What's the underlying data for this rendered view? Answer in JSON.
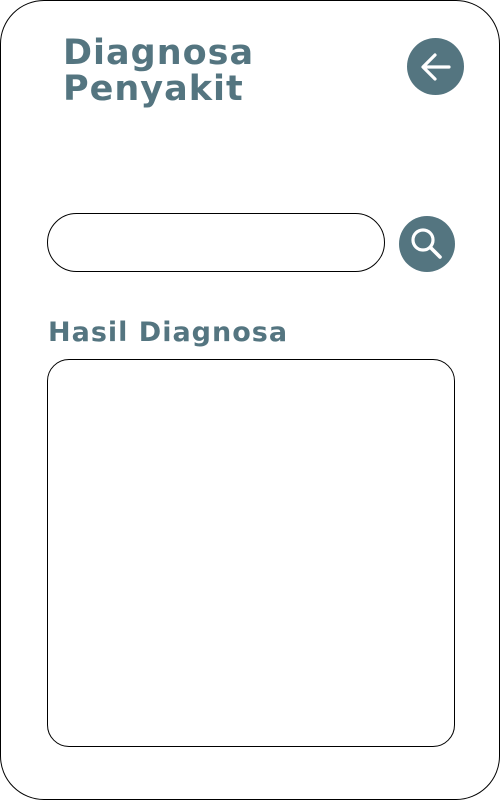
{
  "header": {
    "title_line1": "Diagnosa",
    "title_line2": "Penyakit",
    "back_icon": "arrow-left-icon"
  },
  "search": {
    "value": "",
    "placeholder": "",
    "icon": "search-icon"
  },
  "result": {
    "heading": "Hasil Diagnosa",
    "content": ""
  },
  "colors": {
    "accent": "#547580",
    "background": "#ffffff",
    "outline": "#000000"
  }
}
